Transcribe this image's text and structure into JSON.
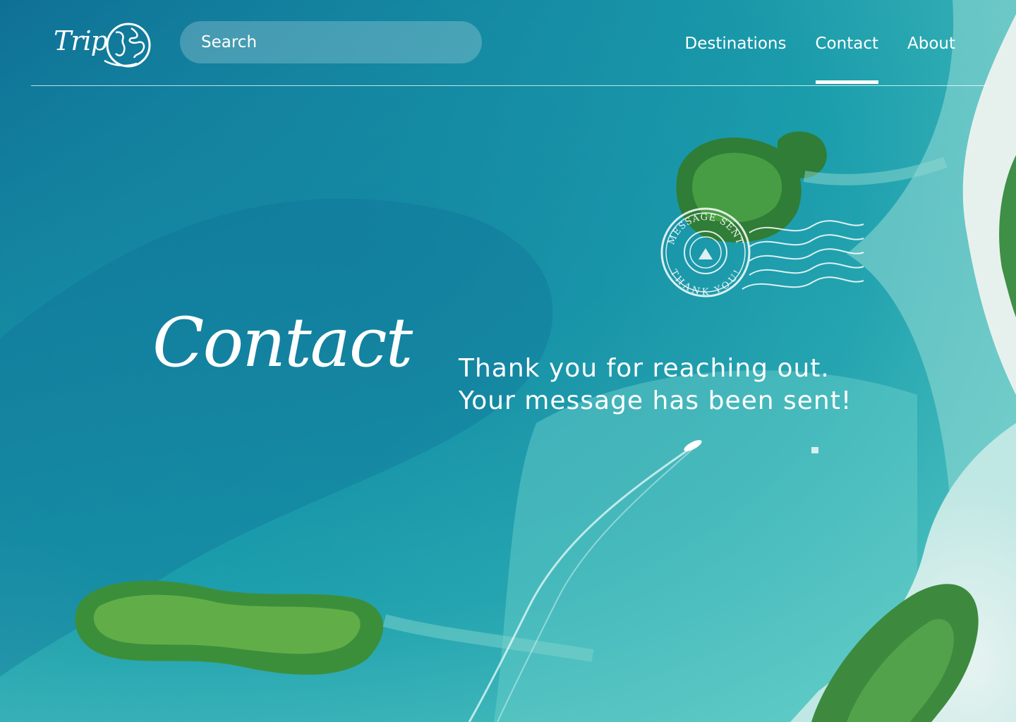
{
  "header": {
    "logo_text": "Trip",
    "search": {
      "placeholder": "Search",
      "value": ""
    },
    "nav": [
      {
        "label": "Destinations",
        "active": false
      },
      {
        "label": "Contact",
        "active": true
      },
      {
        "label": "About",
        "active": false
      }
    ]
  },
  "stamp": {
    "top_text": "MESSAGE SENT",
    "bottom_text": "THANK YOU!"
  },
  "main": {
    "title": "Contact",
    "message_line1": "Thank you for reaching out.",
    "message_line2": "Your message has been sent!"
  },
  "colors": {
    "deep_water": "#0f6f96",
    "lagoon": "#1aa3ad",
    "shallow": "#7fd6d0",
    "sand": "#d9eeee",
    "island_green": "#3c8f3a",
    "text": "#ffffff"
  }
}
